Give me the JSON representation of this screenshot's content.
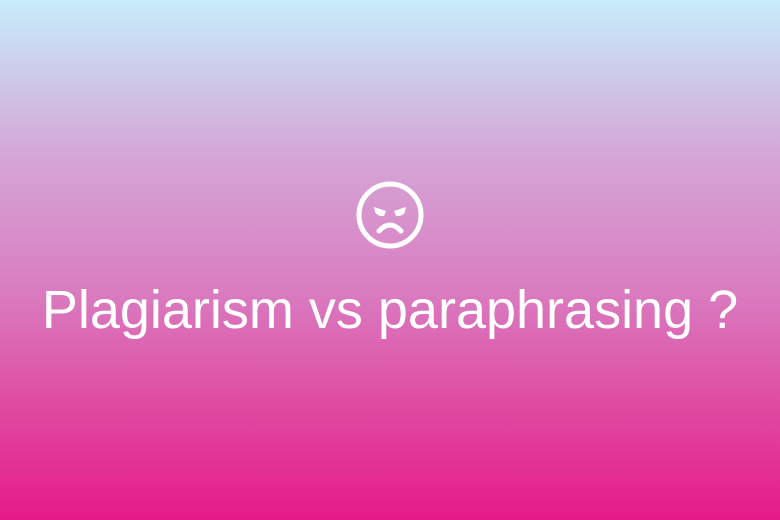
{
  "icon": "angry-face-icon",
  "title": "Plagiarism vs paraphrasing ?",
  "colors": {
    "gradient_top": "#c6ecfb",
    "gradient_bottom": "#e61a8a",
    "text": "#ffffff"
  }
}
